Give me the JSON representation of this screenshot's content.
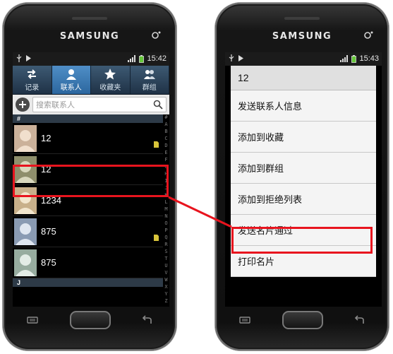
{
  "left_phone": {
    "brand": "SAMSUNG",
    "status_time": "15:42",
    "tabs": [
      {
        "label": "记录",
        "icon": "call-log-icon"
      },
      {
        "label": "联系人",
        "icon": "contact-icon",
        "active": true
      },
      {
        "label": "收藏夹",
        "icon": "star-icon"
      },
      {
        "label": "群组",
        "icon": "group-icon"
      }
    ],
    "search_placeholder": "搜索联系人",
    "section_hash": "#",
    "section_j": "J",
    "contacts": [
      {
        "name": "12",
        "sim": true
      },
      {
        "name": "12",
        "sim": false
      },
      {
        "name": "1234",
        "sim": false
      },
      {
        "name": "875",
        "sim": true
      },
      {
        "name": "875",
        "sim": false
      }
    ],
    "alpha_index": [
      "#",
      "A",
      "B",
      "C",
      "D",
      "E",
      "F",
      "G",
      "H",
      "I",
      "J",
      "K",
      "L",
      "M",
      "N",
      "O",
      "P",
      "Q",
      "R",
      "S",
      "T",
      "U",
      "V",
      "W",
      "X",
      "Y",
      "Z"
    ]
  },
  "right_phone": {
    "brand": "SAMSUNG",
    "status_time": "15:43",
    "menu_title": "12",
    "menu_items": [
      "发送联系人信息",
      "添加到收藏",
      "添加到群组",
      "添加到拒绝列表",
      "发送名片通过",
      "打印名片"
    ]
  },
  "colors": {
    "highlight": "#e8141e",
    "active_tab": "#3d7fbd"
  }
}
